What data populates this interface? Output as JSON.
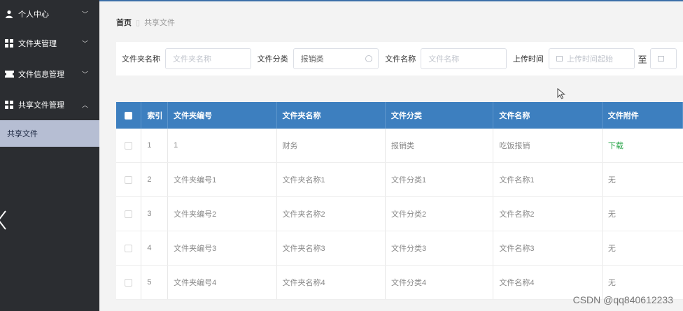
{
  "sidebar": {
    "items": [
      {
        "label": "个人中心",
        "icon": "user-icon",
        "expanded": false
      },
      {
        "label": "文件夹管理",
        "icon": "grid-icon",
        "expanded": false
      },
      {
        "label": "文件信息管理",
        "icon": "ticket-icon",
        "expanded": false
      },
      {
        "label": "共享文件管理",
        "icon": "grid-icon",
        "expanded": true
      }
    ],
    "active_subitem": "共享文件"
  },
  "breadcrumb": {
    "home": "首页",
    "current": "共享文件"
  },
  "filters": {
    "folder_name_label": "文件夹名称",
    "folder_name_placeholder": "文件夹名称",
    "category_label": "文件分类",
    "category_value": "报销类",
    "file_name_label": "文件名称",
    "file_name_placeholder": "文件名称",
    "upload_time_label": "上传时间",
    "upload_start_placeholder": "上传时间起始",
    "to_label": "至"
  },
  "table": {
    "headers": [
      "索引",
      "文件夹编号",
      "文件夹名称",
      "文件分类",
      "文件名称",
      "文件附件"
    ],
    "rows": [
      {
        "index": "1",
        "folder_no": "1",
        "folder_name": "财务",
        "category": "报销类",
        "file_name": "吃饭报销",
        "attachment": "下载",
        "attachment_is_link": true
      },
      {
        "index": "2",
        "folder_no": "文件夹编号1",
        "folder_name": "文件夹名称1",
        "category": "文件分类1",
        "file_name": "文件名称1",
        "attachment": "无",
        "attachment_is_link": false
      },
      {
        "index": "3",
        "folder_no": "文件夹编号2",
        "folder_name": "文件夹名称2",
        "category": "文件分类2",
        "file_name": "文件名称2",
        "attachment": "无",
        "attachment_is_link": false
      },
      {
        "index": "4",
        "folder_no": "文件夹编号3",
        "folder_name": "文件夹名称3",
        "category": "文件分类3",
        "file_name": "文件名称3",
        "attachment": "无",
        "attachment_is_link": false
      },
      {
        "index": "5",
        "folder_no": "文件夹编号4",
        "folder_name": "文件夹名称4",
        "category": "文件分类4",
        "file_name": "文件名称4",
        "attachment": "无",
        "attachment_is_link": false
      }
    ]
  },
  "watermark": "CSDN @qq840612233",
  "colors": {
    "sidebar_bg": "#2b2d31",
    "header_bg": "#3d7fbf",
    "active_sub_bg": "#b6bed3",
    "link_green": "#2aa54a"
  }
}
